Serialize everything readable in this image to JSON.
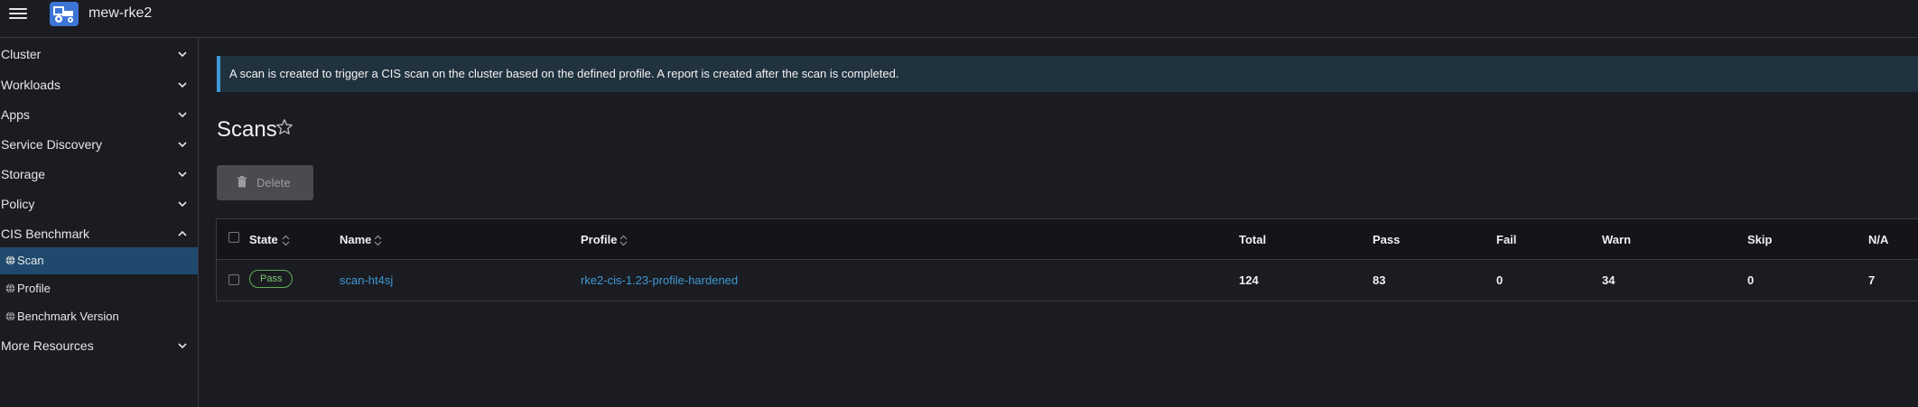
{
  "header": {
    "cluster_name": "mew-rke2",
    "menu_icon": "hamburger-menu-icon",
    "logo_icon": "cluster-tractor-icon"
  },
  "sidebar": {
    "groups": [
      {
        "label": "Cluster",
        "expanded": false
      },
      {
        "label": "Workloads",
        "expanded": false
      },
      {
        "label": "Apps",
        "expanded": false
      },
      {
        "label": "Service Discovery",
        "expanded": false
      },
      {
        "label": "Storage",
        "expanded": false
      },
      {
        "label": "Policy",
        "expanded": false
      },
      {
        "label": "CIS Benchmark",
        "expanded": true
      },
      {
        "label": "More Resources",
        "expanded": false
      }
    ],
    "cis_items": [
      {
        "label": "Scan",
        "active": true
      },
      {
        "label": "Profile",
        "active": false
      },
      {
        "label": "Benchmark Version",
        "active": false
      }
    ]
  },
  "banner": {
    "text": "A scan is created to trigger a CIS scan on the cluster based on the defined profile. A report is created after the scan is completed."
  },
  "page": {
    "title": "Scans",
    "delete_label": "Delete"
  },
  "table": {
    "headers": {
      "state": "State",
      "name": "Name",
      "profile": "Profile",
      "total": "Total",
      "pass": "Pass",
      "fail": "Fail",
      "warn": "Warn",
      "skip": "Skip",
      "na": "N/A"
    },
    "rows": [
      {
        "state": "Pass",
        "name": "scan-ht4sj",
        "profile": "rke2-cis-1.23-profile-hardened",
        "total": "124",
        "pass": "83",
        "fail": "0",
        "warn": "34",
        "skip": "0",
        "na": "7"
      }
    ]
  },
  "colors": {
    "accent": "#3d98d3",
    "active_nav": "#1f4a6e",
    "pass_badge": "#5fad56",
    "logo": "#3d75d6"
  }
}
